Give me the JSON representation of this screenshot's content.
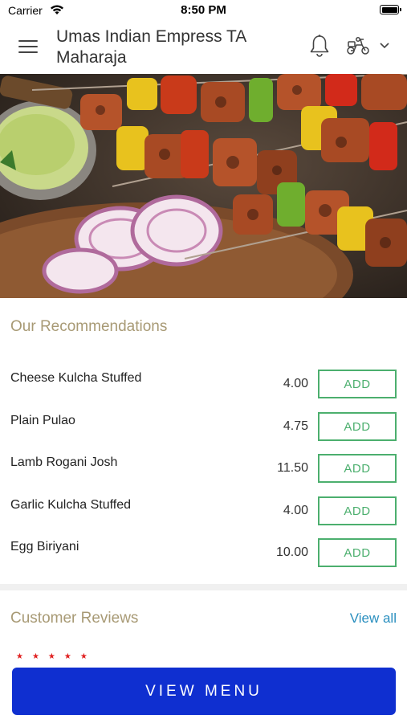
{
  "status_bar": {
    "carrier": "Carrier",
    "time": "8:50 PM"
  },
  "header": {
    "title": "Umas Indian Empress TA Maharaja",
    "icons": [
      "menu-icon",
      "bell-icon",
      "scooter-icon",
      "chevron-down-icon"
    ]
  },
  "hero": {
    "description_icon": "food-hero-image"
  },
  "recommendations": {
    "title": "Our Recommendations",
    "items": [
      {
        "name": "Cheese Kulcha Stuffed",
        "price": "4.00",
        "button": "ADD"
      },
      {
        "name": "Plain Pulao",
        "price": "4.75",
        "button": "ADD"
      },
      {
        "name": "Lamb Rogani Josh",
        "price": "11.50",
        "button": "ADD"
      },
      {
        "name": "Garlic Kulcha Stuffed",
        "price": "4.00",
        "button": "ADD"
      },
      {
        "name": "Egg Biriyani",
        "price": "10.00",
        "button": "ADD"
      }
    ]
  },
  "reviews": {
    "title": "Customer Reviews",
    "view_all": "View all",
    "stars": "★★★★★"
  },
  "footer": {
    "view_menu": "VIEW MENU"
  },
  "colors": {
    "accent_green": "#4caf6e",
    "section_title": "#a89a75",
    "link_blue": "#2a8fbf",
    "button_blue": "#0f2fd0",
    "star_red": "#e02020"
  }
}
